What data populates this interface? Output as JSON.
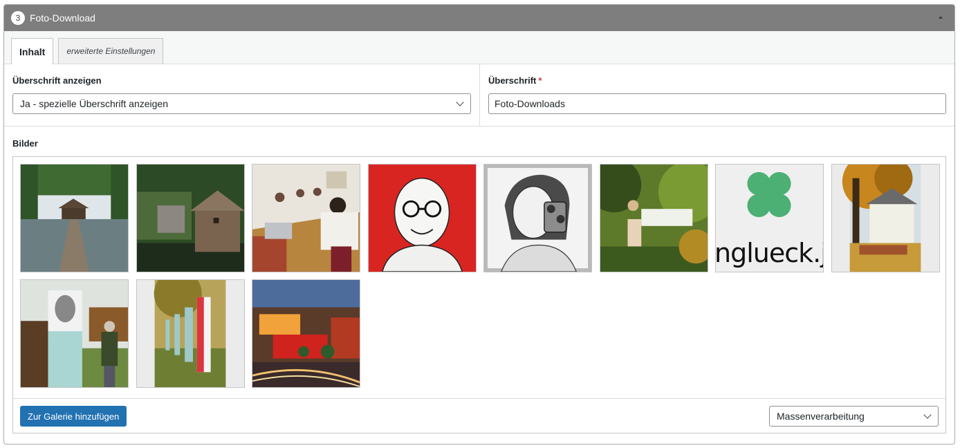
{
  "panel": {
    "step_number": "3",
    "title": "Foto-Download"
  },
  "tabs": [
    {
      "label": "Inhalt",
      "active": true
    },
    {
      "label": "erweiterte Einstellungen",
      "active": false
    }
  ],
  "fields": {
    "show_heading": {
      "label": "Überschrift anzeigen",
      "value": "Ja - spezielle Überschrift anzeigen"
    },
    "heading": {
      "label": "Überschrift",
      "required_mark": "*",
      "value": "Foto-Downloads"
    }
  },
  "images": {
    "label": "Bilder",
    "thumb_text": "nglueck.jo",
    "add_button": "Zur Galerie hinzufügen",
    "bulk_select": "Massenverarbeitung"
  },
  "colors": {
    "header_bg": "#7e7e7e",
    "primary": "#2271b1",
    "required": "#d63638",
    "clover": "#4caf74"
  },
  "icons": [
    "step-number-badge",
    "collapse-arrow-icon",
    "chevron-down-icon"
  ]
}
